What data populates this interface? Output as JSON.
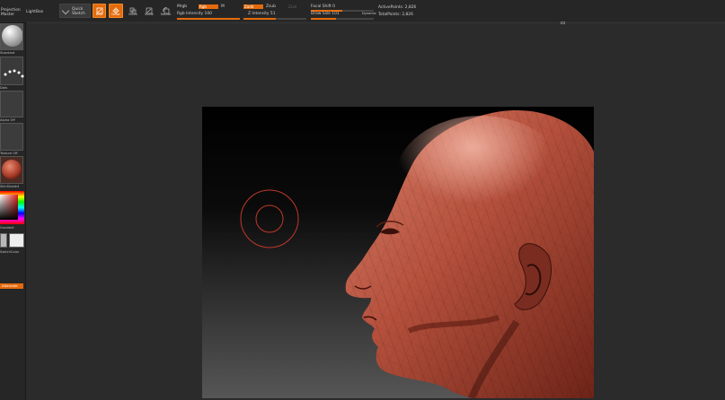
{
  "toolbar": {
    "projection_master_line1": "Projection",
    "projection_master_line2": "Master",
    "lightbox": "LightBox",
    "quick_sketch_line1": "Quick",
    "quick_sketch_line2": "Sketch",
    "edit": "Edit",
    "draw": "Draw",
    "move": "Move",
    "scale": "Scale",
    "rotate": "Rotate",
    "mrgb": "Mrgb",
    "rgb": "Rgb",
    "m": "M",
    "rgb_intensity": "Rgb Intensity 100",
    "zadd": "Zadd",
    "zsub": "Zsub",
    "zcut": "Zcut",
    "z_intensity": "Z Intensity 51",
    "focal_shift": "Focal Shift 0",
    "draw_size": "Draw Size 101",
    "dynamic": "Dynamic",
    "active_points": "ActivePoints: 2,826",
    "total_points": "TotalPoints: 2,826",
    "rgb_intensity_level": 1.0,
    "z_intensity_level": 0.51,
    "focal_shift_level": 0.5,
    "draw_size_level": 0.4
  },
  "left_tray": {
    "brush_label": "Standard",
    "stroke_label": "Dots",
    "alpha_label": "Alpha Off",
    "texture_label": "Texture Off",
    "material_label": "SkinShade4",
    "gradient_label": "Gradient",
    "switch_color_label": "SwitchColor",
    "alternate_label": "Alternate",
    "colors": {
      "accent": "#e46a0c",
      "material": "#c0503a",
      "primary_swatch": "#b8b8b8",
      "secondary_swatch": "#eeeeee"
    }
  },
  "canvas": {
    "model": "head-sculpt-profile",
    "brush_cursor_color": "#c0392b"
  }
}
